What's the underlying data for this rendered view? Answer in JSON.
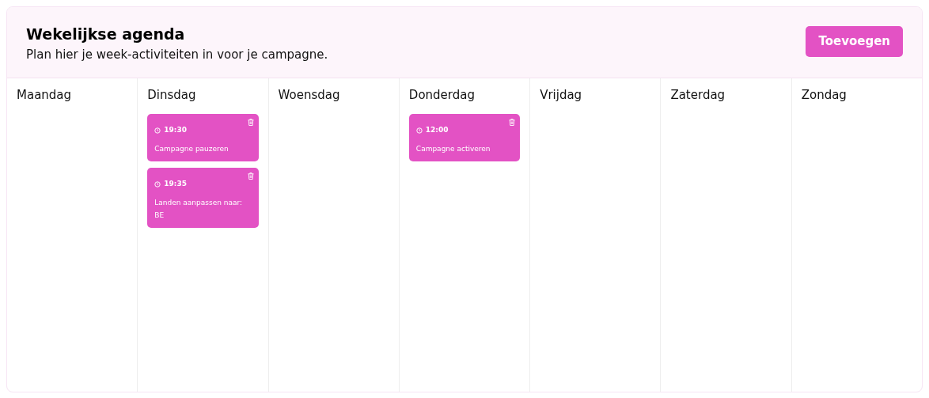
{
  "header": {
    "title": "Wekelijkse agenda",
    "subtitle": "Plan hier je week-activiteiten in voor je campagne.",
    "add_button": "Toevoegen"
  },
  "days": [
    {
      "name": "Maandag"
    },
    {
      "name": "Dinsdag",
      "events": [
        {
          "time": "19:30",
          "label": "Campagne pauzeren"
        },
        {
          "time": "19:35",
          "label": "Landen aanpassen naar: BE"
        }
      ]
    },
    {
      "name": "Woensdag"
    },
    {
      "name": "Donderdag",
      "events": [
        {
          "time": "12:00",
          "label": "Campagne activeren"
        }
      ]
    },
    {
      "name": "Vrijdag"
    },
    {
      "name": "Zaterdag"
    },
    {
      "name": "Zondag"
    }
  ]
}
